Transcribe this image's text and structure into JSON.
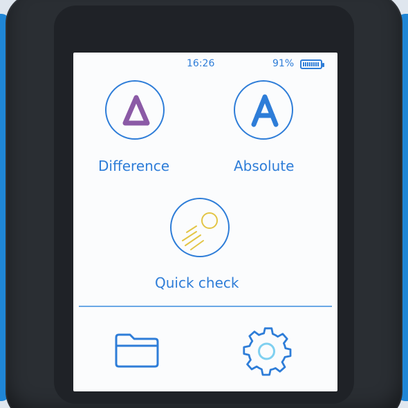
{
  "status_bar": {
    "time": "16:26",
    "battery_percent": "91%",
    "battery_level": 0.91
  },
  "modes": [
    {
      "id": "difference",
      "label": "Difference",
      "icon": "delta-icon",
      "color": "#8b5aa6"
    },
    {
      "id": "absolute",
      "label": "Absolute",
      "icon": "letter-a-icon",
      "color": "#2e7dd8"
    },
    {
      "id": "quick_check",
      "label": "Quick check",
      "icon": "quick-check-icon",
      "color": "#e3c545"
    }
  ],
  "bottom_bar": {
    "items": [
      {
        "id": "files",
        "icon": "folder-icon"
      },
      {
        "id": "settings",
        "icon": "gear-icon"
      }
    ]
  },
  "colors": {
    "accent": "#2e7dd8",
    "screen_bg": "#fbfcfd",
    "housing_blue": "#1f86d6",
    "housing_dark": "#2a2e33"
  }
}
